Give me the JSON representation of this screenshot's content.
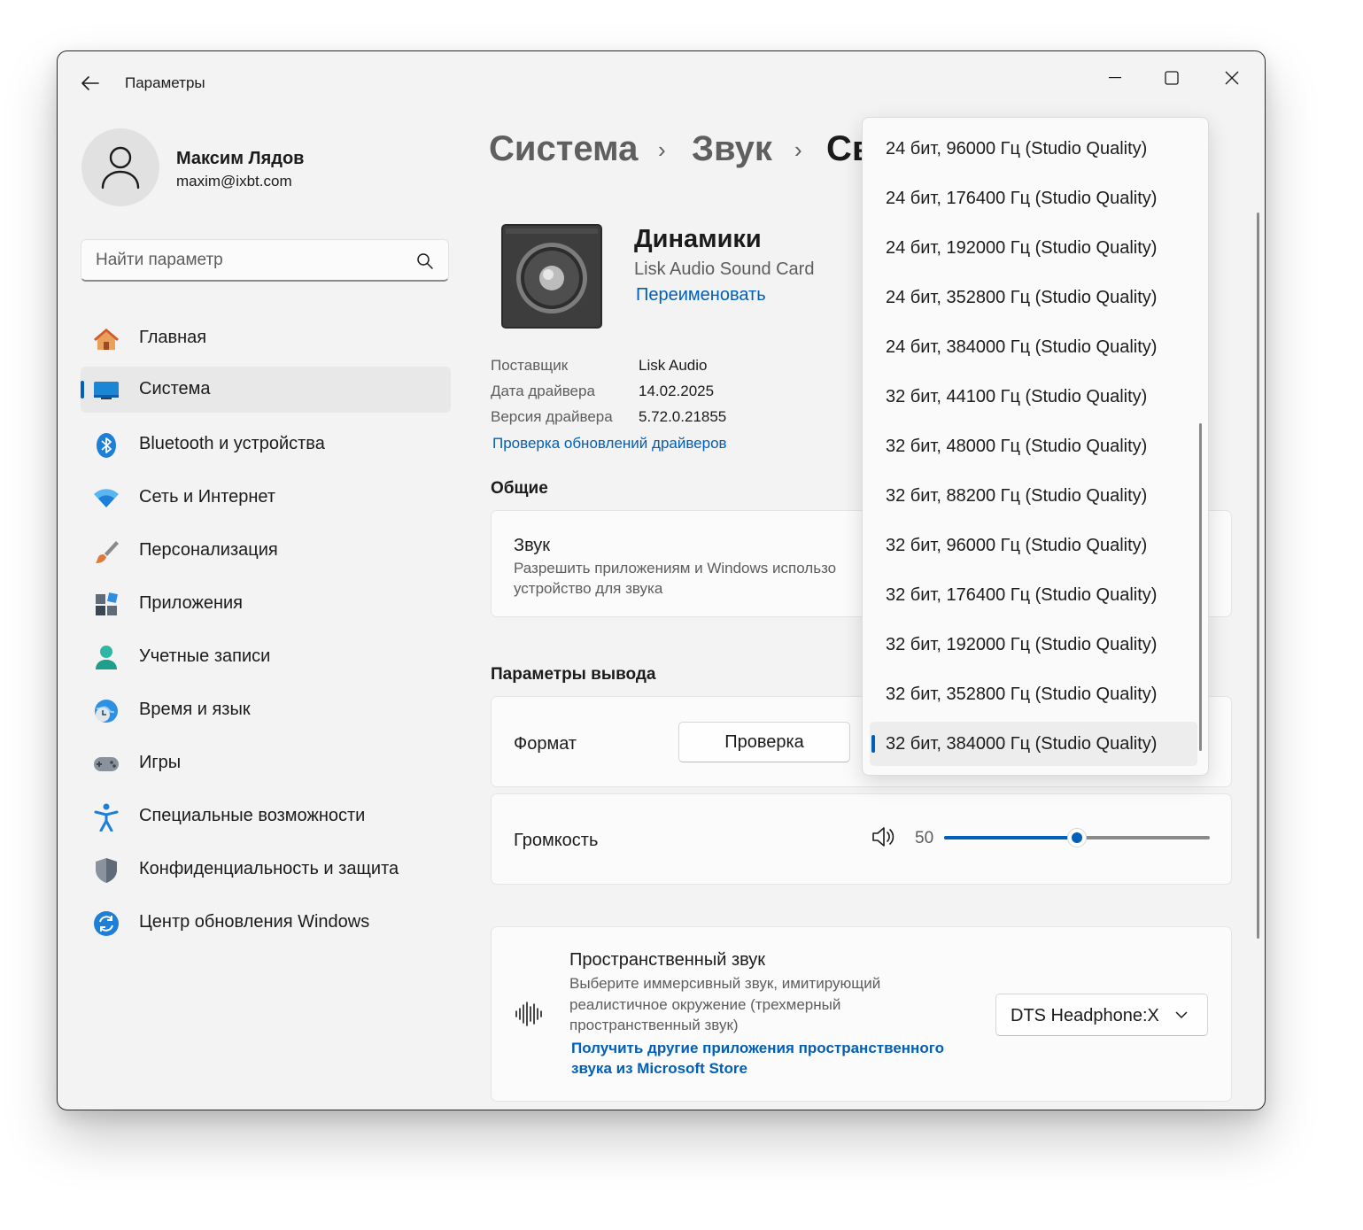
{
  "window": {
    "title": "Параметры"
  },
  "user": {
    "name": "Максим Лядов",
    "email": "maxim@ixbt.com"
  },
  "search": {
    "placeholder": "Найти параметр"
  },
  "nav": [
    {
      "label": "Главная",
      "icon": "home-icon"
    },
    {
      "label": "Система",
      "icon": "system-icon",
      "active": true
    },
    {
      "label": "Bluetooth и устройства",
      "icon": "bluetooth-icon"
    },
    {
      "label": "Сеть и Интернет",
      "icon": "wifi-icon"
    },
    {
      "label": "Персонализация",
      "icon": "brush-icon"
    },
    {
      "label": "Приложения",
      "icon": "apps-icon"
    },
    {
      "label": "Учетные записи",
      "icon": "account-icon"
    },
    {
      "label": "Время и язык",
      "icon": "time-language-icon"
    },
    {
      "label": "Игры",
      "icon": "gamepad-icon"
    },
    {
      "label": "Специальные возможности",
      "icon": "accessibility-icon"
    },
    {
      "label": "Конфиденциальность и защита",
      "icon": "shield-icon"
    },
    {
      "label": "Центр обновления Windows",
      "icon": "update-icon"
    }
  ],
  "breadcrumb": [
    "Система",
    "Звук",
    "Св"
  ],
  "device": {
    "name": "Динамики",
    "subtitle": "Lisk Audio Sound Card",
    "rename": "Переименовать",
    "info": [
      {
        "label": "Поставщик",
        "value": "Lisk Audio"
      },
      {
        "label": "Дата драйвера",
        "value": "14.02.2025"
      },
      {
        "label": "Версия драйвера",
        "value": "5.72.0.21855"
      }
    ],
    "driver_update_link": "Проверка обновлений драйверов"
  },
  "general": {
    "heading": "Общие",
    "sound_title": "Звук",
    "sound_desc_line1": "Разрешить приложениям и Windows использо",
    "sound_desc_line2": "устройство для звука"
  },
  "output": {
    "heading": "Параметры вывода",
    "format_label": "Формат",
    "test_button": "Проверка",
    "volume_label": "Громкость",
    "volume_value": "50",
    "volume_level": 0.5
  },
  "format_options": [
    "24 бит, 96000 Гц (Studio Quality)",
    "24 бит, 176400 Гц (Studio Quality)",
    "24 бит, 192000 Гц (Studio Quality)",
    "24 бит, 352800 Гц (Studio Quality)",
    "24 бит, 384000 Гц (Studio Quality)",
    "32 бит, 44100 Гц (Studio Quality)",
    "32 бит, 48000 Гц (Studio Quality)",
    "32 бит, 88200 Гц (Studio Quality)",
    "32 бит, 96000 Гц (Studio Quality)",
    "32 бит, 176400 Гц (Studio Quality)",
    "32 бит, 192000 Гц (Studio Quality)",
    "32 бит, 352800 Гц (Studio Quality)",
    "32 бит, 384000 Гц (Studio Quality)"
  ],
  "selected_format_index": 12,
  "spatial": {
    "title": "Пространственный звук",
    "desc_line1": "Выберите иммерсивный звук, имитирующий",
    "desc_line2": "реалистичное окружение (трехмерный",
    "desc_line3": "пространственный звук)",
    "link_line1": "Получить другие приложения пространственного",
    "link_line2": "звука из Microsoft Store",
    "selected": "DTS Headphone:X"
  },
  "colors": {
    "accent": "#005fb8",
    "background": "#f3f3f3",
    "card": "#fbfbfb"
  }
}
